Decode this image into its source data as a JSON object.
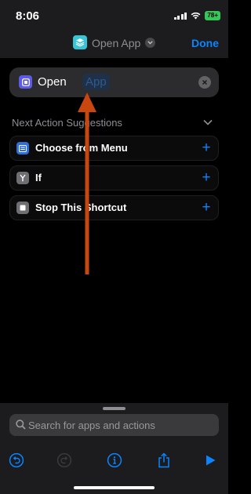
{
  "status_bar": {
    "time": "8:06",
    "battery": "78+"
  },
  "header": {
    "title": "Open App",
    "done_label": "Done"
  },
  "action": {
    "verb": "Open",
    "parameter_placeholder": "App"
  },
  "suggestions": {
    "header": "Next Action Suggestions",
    "items": [
      {
        "label": "Choose from Menu",
        "icon": "menu-list-icon",
        "icon_color": "#2f6fd8"
      },
      {
        "label": "If",
        "icon": "branch-icon",
        "icon_color": "#6e6e73"
      },
      {
        "label": "Stop This Shortcut",
        "icon": "stop-icon",
        "icon_color": "#6e6e73"
      }
    ]
  },
  "search": {
    "placeholder": "Search for apps and actions"
  },
  "colors": {
    "accent": "#0a84ff",
    "annotation_arrow": "#c8470f",
    "background": "#000000"
  }
}
